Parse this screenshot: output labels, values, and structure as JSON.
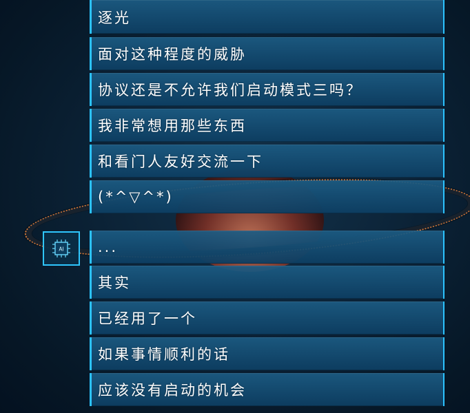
{
  "dialogue": {
    "lines": [
      "逐光",
      "面对这种程度的威胁",
      "协议还是不允许我们启动模式三吗？",
      "我非常想用那些东西",
      "和看门人友好交流一下",
      "(*^▽^*)",
      "...",
      "其实",
      "已经用了一个",
      "如果事情顺利的话",
      "应该没有启动的机会"
    ]
  },
  "speaker": {
    "badge_label": "AI",
    "icon": "chip-icon"
  },
  "colors": {
    "accent": "#2cc3ff",
    "panel": "#13557f",
    "text": "#ffffff"
  }
}
